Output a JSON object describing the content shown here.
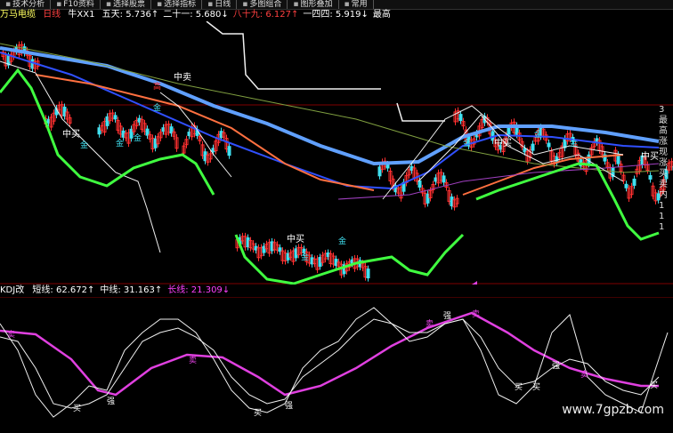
{
  "toolbar": {
    "items": [
      {
        "label": "技术分析",
        "icon": "chart-icon"
      },
      {
        "label": "F10资料",
        "icon": "doc-icon"
      },
      {
        "label": "选择股票",
        "icon": "list-icon"
      },
      {
        "label": "选择指标",
        "icon": "list-icon"
      },
      {
        "label": "日线",
        "icon": "calendar-icon"
      },
      {
        "label": "多图组合",
        "icon": "grid-icon"
      },
      {
        "label": "图形叠加",
        "icon": "overlay-icon"
      },
      {
        "label": "常用",
        "icon": "star-icon"
      }
    ]
  },
  "header": {
    "stock": "万马电缆",
    "period": "日线",
    "indicator": "牛XX1",
    "items": [
      {
        "text": "五天: 5.736↑",
        "color": "#ffffff"
      },
      {
        "text": "二十一: 5.680↓",
        "color": "#ffffff"
      },
      {
        "text": "八十九: 6.127↑",
        "color": "#ff4040"
      },
      {
        "text": "一四四: 5.919↓",
        "color": "#ffffff"
      },
      {
        "text": "最高",
        "color": "#ffffff"
      }
    ]
  },
  "price_markers": {
    "mid_sell": "中卖",
    "mid_buy": "中买",
    "gold": "金",
    "high": "高"
  },
  "right_axis": {
    "labels": [
      "3",
      "最",
      "高",
      "涨",
      "现",
      "涨",
      "买",
      "卖",
      "内",
      "1",
      "1",
      "1"
    ]
  },
  "indicator_header": {
    "name": "KDJ改",
    "items": [
      {
        "text": "短线: 62.672↑",
        "color": "#ffffff"
      },
      {
        "text": "中线: 31.163↑",
        "color": "#ffffff"
      },
      {
        "text": "长线: 21.309↓",
        "color": "#ff40ff"
      }
    ]
  },
  "indicator_markers": {
    "buy": "买",
    "strong": "强",
    "sell": "卖"
  },
  "colors": {
    "up": "#ff3030",
    "down": "#40e0f0",
    "ma_blue": "#3050ff",
    "ma_light_blue": "#60a0ff",
    "ma_orange": "#ff7040",
    "ma_green": "#40ff40",
    "ma_white": "#f0f0f0",
    "ma_purple": "#c040ff",
    "kdj_long": "#e040e0",
    "grid_red": "#800000"
  },
  "watermark": "www.7gpzb.com"
}
